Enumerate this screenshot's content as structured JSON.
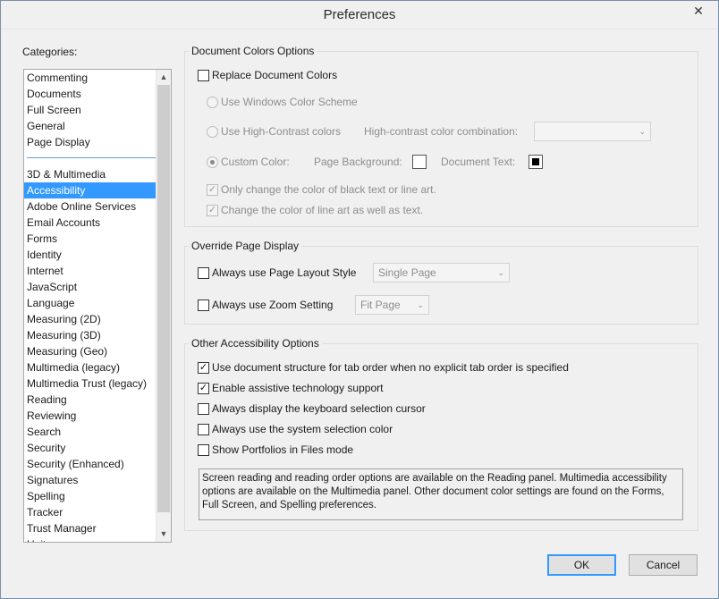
{
  "window": {
    "title": "Preferences",
    "close_glyph": "✕"
  },
  "categories": {
    "label": "Categories:",
    "group1": [
      "Commenting",
      "Documents",
      "Full Screen",
      "General",
      "Page Display"
    ],
    "group2": [
      "3D & Multimedia",
      "Accessibility",
      "Adobe Online Services",
      "Email Accounts",
      "Forms",
      "Identity",
      "Internet",
      "JavaScript",
      "Language",
      "Measuring (2D)",
      "Measuring (3D)",
      "Measuring (Geo)",
      "Multimedia (legacy)",
      "Multimedia Trust (legacy)",
      "Reading",
      "Reviewing",
      "Search",
      "Security",
      "Security (Enhanced)",
      "Signatures",
      "Spelling",
      "Tracker",
      "Trust Manager",
      "Units"
    ],
    "selected": "Accessibility"
  },
  "doc_colors": {
    "title": "Document Colors Options",
    "replace_label": "Replace Document Colors",
    "windows_scheme_label": "Use Windows Color Scheme",
    "high_contrast_label": "Use High-Contrast colors",
    "hc_combo_label": "High-contrast color combination:",
    "hc_combo_value": "",
    "custom_color_label": "Custom Color:",
    "page_bg_label": "Page Background:",
    "page_bg_color": "#ffffff",
    "doc_text_label": "Document Text:",
    "doc_text_color": "#000000",
    "only_black_label": "Only change the color of black text or line art.",
    "line_art_label": "Change the color of line art as well as text."
  },
  "override": {
    "title": "Override Page Display",
    "layout_label": "Always use Page Layout Style",
    "layout_value": "Single Page",
    "zoom_label": "Always use Zoom Setting",
    "zoom_value": "Fit Page"
  },
  "other": {
    "title": "Other Accessibility Options",
    "options": [
      {
        "label": "Use document structure for tab order when no explicit tab order is specified",
        "checked": true
      },
      {
        "label": "Enable assistive technology support",
        "checked": true
      },
      {
        "label": "Always display the keyboard selection cursor",
        "checked": false
      },
      {
        "label": "Always use the system selection color",
        "checked": false
      },
      {
        "label": "Show Portfolios in Files mode",
        "checked": false
      }
    ],
    "info": "Screen reading and reading order options are available on the Reading panel. Multimedia accessibility options are available on the Multimedia panel. Other document color settings are found on the Forms, Full Screen, and Spelling preferences."
  },
  "buttons": {
    "ok": "OK",
    "cancel": "Cancel"
  },
  "glyphs": {
    "check": "✓",
    "down": "⌄",
    "scroll_up": "▲",
    "scroll_down": "▼"
  },
  "icons": {
    "close": "close-icon",
    "combo": "chevron-down-icon"
  },
  "colors": {
    "selection": "#3399ff",
    "default_button_border": "#3399ff"
  }
}
